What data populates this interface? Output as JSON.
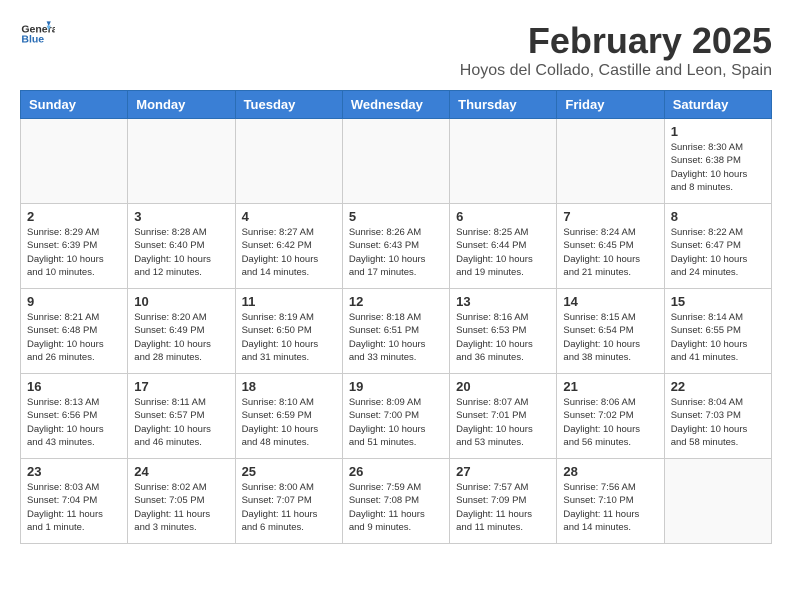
{
  "header": {
    "logo_general": "General",
    "logo_blue": "Blue",
    "month_title": "February 2025",
    "location": "Hoyos del Collado, Castille and Leon, Spain"
  },
  "days_of_week": [
    "Sunday",
    "Monday",
    "Tuesday",
    "Wednesday",
    "Thursday",
    "Friday",
    "Saturday"
  ],
  "weeks": [
    [
      {
        "day": "",
        "info": ""
      },
      {
        "day": "",
        "info": ""
      },
      {
        "day": "",
        "info": ""
      },
      {
        "day": "",
        "info": ""
      },
      {
        "day": "",
        "info": ""
      },
      {
        "day": "",
        "info": ""
      },
      {
        "day": "1",
        "info": "Sunrise: 8:30 AM\nSunset: 6:38 PM\nDaylight: 10 hours\nand 8 minutes."
      }
    ],
    [
      {
        "day": "2",
        "info": "Sunrise: 8:29 AM\nSunset: 6:39 PM\nDaylight: 10 hours\nand 10 minutes."
      },
      {
        "day": "3",
        "info": "Sunrise: 8:28 AM\nSunset: 6:40 PM\nDaylight: 10 hours\nand 12 minutes."
      },
      {
        "day": "4",
        "info": "Sunrise: 8:27 AM\nSunset: 6:42 PM\nDaylight: 10 hours\nand 14 minutes."
      },
      {
        "day": "5",
        "info": "Sunrise: 8:26 AM\nSunset: 6:43 PM\nDaylight: 10 hours\nand 17 minutes."
      },
      {
        "day": "6",
        "info": "Sunrise: 8:25 AM\nSunset: 6:44 PM\nDaylight: 10 hours\nand 19 minutes."
      },
      {
        "day": "7",
        "info": "Sunrise: 8:24 AM\nSunset: 6:45 PM\nDaylight: 10 hours\nand 21 minutes."
      },
      {
        "day": "8",
        "info": "Sunrise: 8:22 AM\nSunset: 6:47 PM\nDaylight: 10 hours\nand 24 minutes."
      }
    ],
    [
      {
        "day": "9",
        "info": "Sunrise: 8:21 AM\nSunset: 6:48 PM\nDaylight: 10 hours\nand 26 minutes."
      },
      {
        "day": "10",
        "info": "Sunrise: 8:20 AM\nSunset: 6:49 PM\nDaylight: 10 hours\nand 28 minutes."
      },
      {
        "day": "11",
        "info": "Sunrise: 8:19 AM\nSunset: 6:50 PM\nDaylight: 10 hours\nand 31 minutes."
      },
      {
        "day": "12",
        "info": "Sunrise: 8:18 AM\nSunset: 6:51 PM\nDaylight: 10 hours\nand 33 minutes."
      },
      {
        "day": "13",
        "info": "Sunrise: 8:16 AM\nSunset: 6:53 PM\nDaylight: 10 hours\nand 36 minutes."
      },
      {
        "day": "14",
        "info": "Sunrise: 8:15 AM\nSunset: 6:54 PM\nDaylight: 10 hours\nand 38 minutes."
      },
      {
        "day": "15",
        "info": "Sunrise: 8:14 AM\nSunset: 6:55 PM\nDaylight: 10 hours\nand 41 minutes."
      }
    ],
    [
      {
        "day": "16",
        "info": "Sunrise: 8:13 AM\nSunset: 6:56 PM\nDaylight: 10 hours\nand 43 minutes."
      },
      {
        "day": "17",
        "info": "Sunrise: 8:11 AM\nSunset: 6:57 PM\nDaylight: 10 hours\nand 46 minutes."
      },
      {
        "day": "18",
        "info": "Sunrise: 8:10 AM\nSunset: 6:59 PM\nDaylight: 10 hours\nand 48 minutes."
      },
      {
        "day": "19",
        "info": "Sunrise: 8:09 AM\nSunset: 7:00 PM\nDaylight: 10 hours\nand 51 minutes."
      },
      {
        "day": "20",
        "info": "Sunrise: 8:07 AM\nSunset: 7:01 PM\nDaylight: 10 hours\nand 53 minutes."
      },
      {
        "day": "21",
        "info": "Sunrise: 8:06 AM\nSunset: 7:02 PM\nDaylight: 10 hours\nand 56 minutes."
      },
      {
        "day": "22",
        "info": "Sunrise: 8:04 AM\nSunset: 7:03 PM\nDaylight: 10 hours\nand 58 minutes."
      }
    ],
    [
      {
        "day": "23",
        "info": "Sunrise: 8:03 AM\nSunset: 7:04 PM\nDaylight: 11 hours\nand 1 minute."
      },
      {
        "day": "24",
        "info": "Sunrise: 8:02 AM\nSunset: 7:05 PM\nDaylight: 11 hours\nand 3 minutes."
      },
      {
        "day": "25",
        "info": "Sunrise: 8:00 AM\nSunset: 7:07 PM\nDaylight: 11 hours\nand 6 minutes."
      },
      {
        "day": "26",
        "info": "Sunrise: 7:59 AM\nSunset: 7:08 PM\nDaylight: 11 hours\nand 9 minutes."
      },
      {
        "day": "27",
        "info": "Sunrise: 7:57 AM\nSunset: 7:09 PM\nDaylight: 11 hours\nand 11 minutes."
      },
      {
        "day": "28",
        "info": "Sunrise: 7:56 AM\nSunset: 7:10 PM\nDaylight: 11 hours\nand 14 minutes."
      },
      {
        "day": "",
        "info": ""
      }
    ]
  ]
}
